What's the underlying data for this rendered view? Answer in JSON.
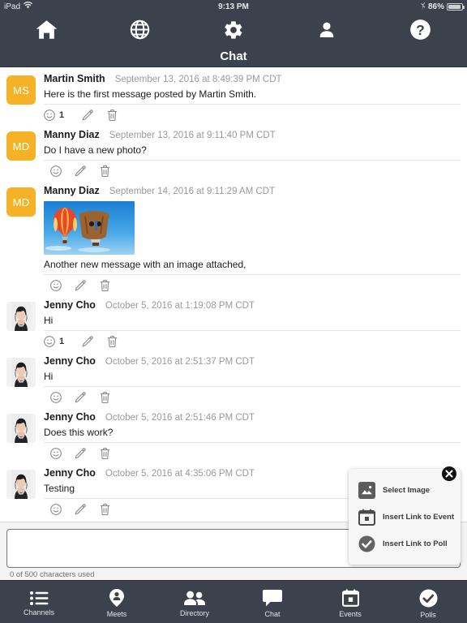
{
  "statusbar": {
    "device": "iPad",
    "wifi_icon": "wifi-icon",
    "time": "9:13 PM",
    "bluetooth_icon": "bluetooth-icon",
    "battery": "86%"
  },
  "topnav": {
    "items": [
      {
        "name": "home",
        "icon": "home-icon"
      },
      {
        "name": "globe",
        "icon": "globe-icon"
      },
      {
        "name": "settings",
        "icon": "gear-icon"
      },
      {
        "name": "profile",
        "icon": "person-icon"
      },
      {
        "name": "help",
        "icon": "question-mark-icon"
      }
    ]
  },
  "header": {
    "title": "Chat"
  },
  "messages": [
    {
      "author": "Martin Smith",
      "initials": "MS",
      "avatar_color": "#f6b227",
      "avatar_type": "initials",
      "time": "September 13, 2016 at 8:49:39 PM CDT",
      "text": "Here is the first message posted by Martin Smith.",
      "reaction_count": "1",
      "has_image": false
    },
    {
      "author": "Manny Diaz",
      "initials": "MD",
      "avatar_color": "#f6b227",
      "avatar_type": "initials",
      "time": "September 13, 2016 at 9:11:40 PM CDT",
      "text": "Do I have a new photo?",
      "reaction_count": "",
      "has_image": false
    },
    {
      "author": "Manny Diaz",
      "initials": "MD",
      "avatar_color": "#f6b227",
      "avatar_type": "initials",
      "time": "September 14, 2016 at 9:11:29 AM CDT",
      "text": "Another new message with an image attached,",
      "reaction_count": "",
      "has_image": true,
      "image_alt": "hot-air-balloons-photo"
    },
    {
      "author": "Jenny Cho",
      "initials": "JC",
      "avatar_color": "#f1f1f1",
      "avatar_type": "photo",
      "time": "October 5, 2016 at 1:19:08 PM CDT",
      "text": "Hi",
      "reaction_count": "1",
      "has_image": false
    },
    {
      "author": "Jenny Cho",
      "initials": "JC",
      "avatar_color": "#f1f1f1",
      "avatar_type": "photo",
      "time": "October 5, 2016 at 2:51:37 PM CDT",
      "text": "Hi",
      "reaction_count": "",
      "has_image": false
    },
    {
      "author": "Jenny Cho",
      "initials": "JC",
      "avatar_color": "#f1f1f1",
      "avatar_type": "photo",
      "time": "October 5, 2016 at 2:51:46 PM CDT",
      "text": "Does this work?",
      "reaction_count": "",
      "has_image": false
    },
    {
      "author": "Jenny Cho",
      "initials": "JC",
      "avatar_color": "#f1f1f1",
      "avatar_type": "photo",
      "time": "October 5, 2016 at 4:35:06 PM CDT",
      "text": "Testing",
      "reaction_count": "",
      "has_image": false
    }
  ],
  "message_actions": {
    "react_icon": "smiley-face-icon",
    "edit_icon": "pencil-icon",
    "delete_icon": "trash-icon"
  },
  "composer": {
    "value": "",
    "placeholder": "",
    "char_counter": "0 of 500 characters used"
  },
  "attachment_popup": {
    "close_icon": "close-circle-icon",
    "items": [
      {
        "label": "Select Image",
        "icon": "image-icon"
      },
      {
        "label": "Insert Link to Event",
        "icon": "calendar-icon"
      },
      {
        "label": "Insert Link to Poll",
        "icon": "check-circle-icon"
      }
    ]
  },
  "tabbar": {
    "items": [
      {
        "label": "Channels",
        "icon": "list-icon"
      },
      {
        "label": "Meets",
        "icon": "map-pin-person-icon"
      },
      {
        "label": "Directory",
        "icon": "people-icon"
      },
      {
        "label": "Chat",
        "icon": "speech-bubble-icon"
      },
      {
        "label": "Events",
        "icon": "calendar-icon"
      },
      {
        "label": "Polls",
        "icon": "check-circle-icon"
      }
    ]
  },
  "colors": {
    "chrome": "#3b424b",
    "avatar_amber": "#f6b227",
    "text": "#1b1b1b",
    "muted": "#9a9a9a"
  }
}
